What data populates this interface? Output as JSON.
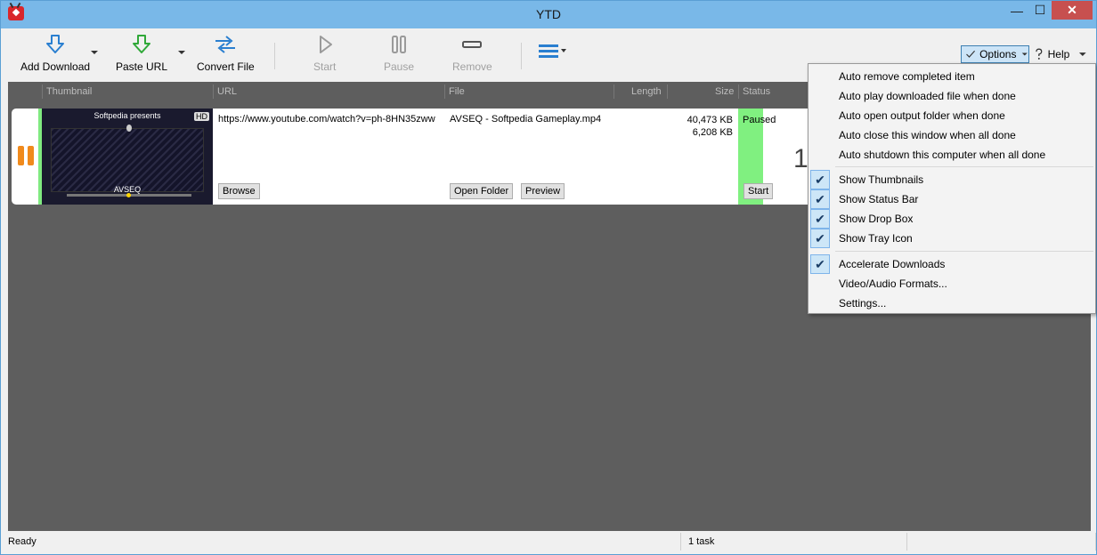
{
  "window": {
    "title": "YTD"
  },
  "titlebar": {
    "min_icon": "—",
    "max_icon": "☐",
    "close_icon": "✕"
  },
  "toolbar": {
    "add_download": "Add Download",
    "paste_url": "Paste URL",
    "convert_file": "Convert File",
    "start": "Start",
    "pause": "Pause",
    "remove": "Remove",
    "options": "Options",
    "help": "Help"
  },
  "columns": {
    "thumbnail": "Thumbnail",
    "url": "URL",
    "file": "File",
    "length": "Length",
    "size": "Size",
    "status": "Status"
  },
  "download": {
    "thumb_title": "Softpedia presents",
    "thumb_hd": "HD",
    "thumb_caption": "AVSEQ",
    "url": "https://www.youtube.com/watch?v=ph-8HN35zww",
    "file": "AVSEQ - Softpedia Gameplay.mp4",
    "size_total": "40,473 KB",
    "size_done": "6,208 KB",
    "status": "Paused",
    "big_number": "1",
    "browse_label": "Browse",
    "open_folder_label": "Open Folder",
    "preview_label": "Preview",
    "start_label": "Start"
  },
  "menu": {
    "auto_remove": "Auto remove completed item",
    "auto_play": "Auto play downloaded file when done",
    "auto_open": "Auto open output folder when done",
    "auto_close": "Auto close this window when all done",
    "auto_shutdown": "Auto shutdown this computer when all done",
    "show_thumbnails": "Show Thumbnails",
    "show_status_bar": "Show Status Bar",
    "show_drop_box": "Show Drop Box",
    "show_tray_icon": "Show Tray Icon",
    "accelerate": "Accelerate Downloads",
    "formats": "Video/Audio Formats...",
    "settings": "Settings..."
  },
  "statusbar": {
    "left": "Ready",
    "tasks": "1 task"
  },
  "colors": {
    "accent": "#79b8e8",
    "status_green": "#80f080",
    "pause_orange": "#f08a1c"
  }
}
